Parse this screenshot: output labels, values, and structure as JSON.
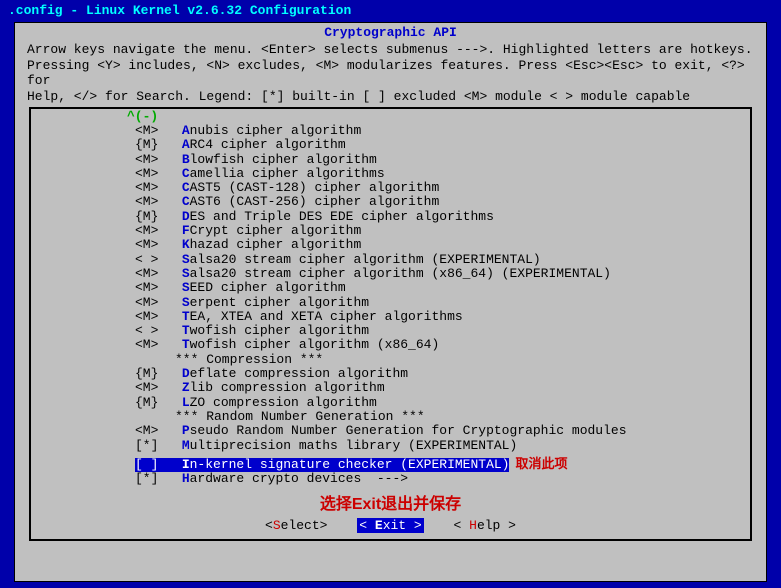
{
  "window_title": ".config - Linux Kernel v2.6.32 Configuration",
  "heading": "Cryptographic API",
  "help_lines": [
    "Arrow keys navigate the menu.  <Enter> selects submenus --->.  Highlighted letters are hotkeys.",
    "Pressing <Y> includes, <N> excludes, <M> modularizes features.  Press <Esc><Esc> to exit, <?> for",
    "Help, </> for Search.  Legend: [*] built-in  [ ] excluded  <M> module  < > module capable"
  ],
  "scroll_indicator": "^(-)",
  "items": [
    {
      "mark": "<M>",
      "hot": "A",
      "rest": "nubis cipher algorithm"
    },
    {
      "mark": "{M}",
      "hot": "A",
      "rest": "RC4 cipher algorithm"
    },
    {
      "mark": "<M>",
      "hot": "B",
      "rest": "lowfish cipher algorithm"
    },
    {
      "mark": "<M>",
      "hot": "C",
      "rest": "amellia cipher algorithms"
    },
    {
      "mark": "<M>",
      "hot": "C",
      "rest": "AST5 (CAST-128) cipher algorithm"
    },
    {
      "mark": "<M>",
      "hot": "C",
      "rest": "AST6 (CAST-256) cipher algorithm"
    },
    {
      "mark": "{M}",
      "hot": "D",
      "rest": "ES and Triple DES EDE cipher algorithms"
    },
    {
      "mark": "<M>",
      "hot": "F",
      "rest": "Crypt cipher algorithm"
    },
    {
      "mark": "<M>",
      "hot": "K",
      "rest": "hazad cipher algorithm"
    },
    {
      "mark": "< >",
      "hot": "S",
      "rest": "alsa20 stream cipher algorithm (EXPERIMENTAL)"
    },
    {
      "mark": "<M>",
      "hot": "S",
      "rest": "alsa20 stream cipher algorithm (x86_64) (EXPERIMENTAL)"
    },
    {
      "mark": "<M>",
      "hot": "S",
      "rest": "EED cipher algorithm"
    },
    {
      "mark": "<M>",
      "hot": "S",
      "rest": "erpent cipher algorithm"
    },
    {
      "mark": "<M>",
      "hot": "T",
      "rest": "EA, XTEA and XETA cipher algorithms"
    },
    {
      "mark": "< >",
      "hot": "T",
      "rest": "wofish cipher algorithm"
    },
    {
      "mark": "<M>",
      "hot": "T",
      "rest": "wofish cipher algorithm (x86_64)"
    },
    {
      "plain": "*** Compression ***"
    },
    {
      "mark": "{M}",
      "hot": "D",
      "rest": "eflate compression algorithm"
    },
    {
      "mark": "<M>",
      "hot": "Z",
      "rest": "lib compression algorithm"
    },
    {
      "mark": "{M}",
      "hot": "L",
      "rest": "ZO compression algorithm"
    },
    {
      "plain": "*** Random Number Generation ***"
    },
    {
      "mark": "<M>",
      "hot": "P",
      "rest": "seudo Random Number Generation for Cryptographic modules"
    },
    {
      "mark": "[*]",
      "hot": "M",
      "rest": "ultiprecision maths library (EXPERIMENTAL)"
    },
    {
      "mark": "[ ]",
      "hot": "I",
      "rest": "n-kernel signature checker (EXPERIMENTAL)",
      "selected": true
    },
    {
      "mark": "[*]",
      "hot": "H",
      "rest": "ardware crypto devices  --->"
    }
  ],
  "annotation_inline": "取消此项",
  "annotation_bottom": "选择Exit退出并保存",
  "buttons": {
    "select": {
      "open": "<",
      "hot": "S",
      "rest": "elect>",
      "close": ""
    },
    "exit": {
      "open": "< ",
      "hot": "E",
      "rest": "xit >",
      "close": ""
    },
    "help": {
      "open": "< ",
      "hot": "H",
      "rest": "elp >",
      "close": ""
    }
  }
}
